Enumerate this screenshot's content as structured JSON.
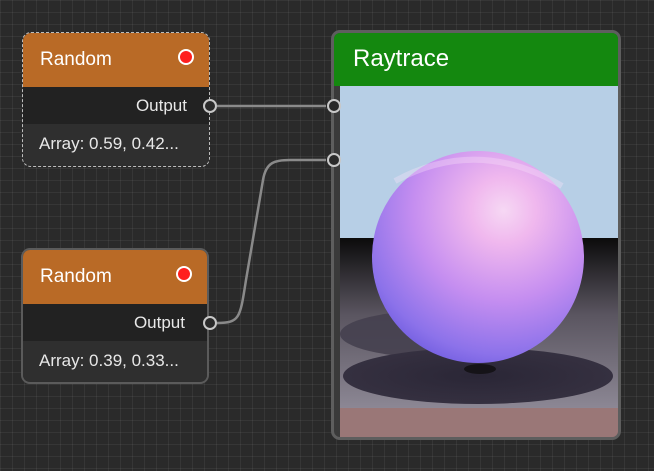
{
  "nodes": {
    "random_1": {
      "title": "Random",
      "output_label": "Output",
      "value_text": "Array: 0.59, 0.42...",
      "selected": true
    },
    "random_2": {
      "title": "Random",
      "output_label": "Output",
      "value_text": "Array: 0.39, 0.33...",
      "selected": false
    },
    "raytrace": {
      "title": "Raytrace"
    }
  },
  "colors": {
    "canvas_bg": "#2a2a2a",
    "random_header": "#b96a26",
    "raytrace_header": "#14880f",
    "status_dot": "#ff1f1f",
    "wire": "#8a8a8a"
  },
  "icons": {
    "status": "status-dot-icon",
    "port": "port-circle-icon"
  }
}
